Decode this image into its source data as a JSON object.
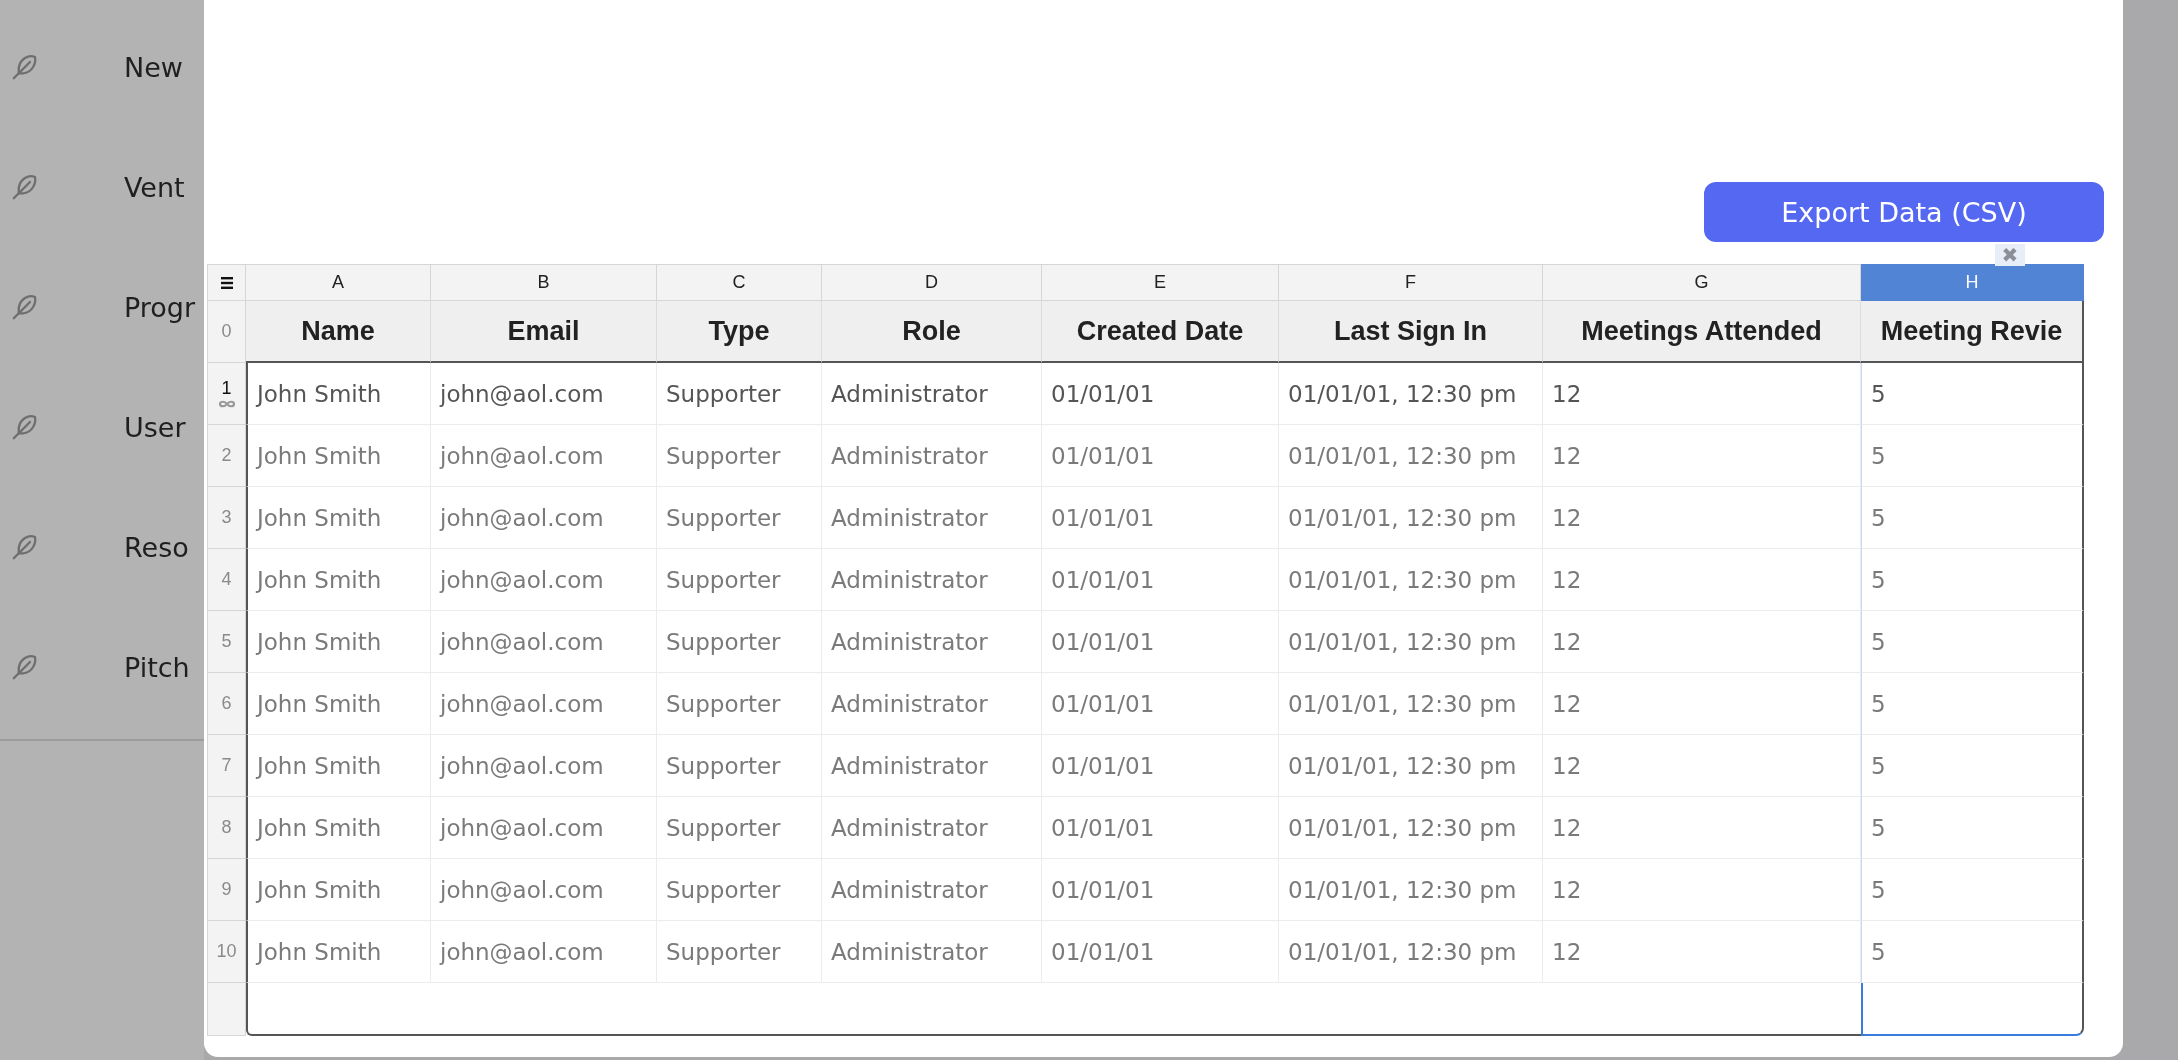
{
  "sidebar": {
    "items": [
      {
        "label": "New"
      },
      {
        "label": "Vent"
      },
      {
        "label": "Progr"
      },
      {
        "label": "User"
      },
      {
        "label": "Reso"
      },
      {
        "label": "Pitch"
      }
    ]
  },
  "export_button": {
    "label": "Export Data (CSV)"
  },
  "close_icon": "✖",
  "sheet": {
    "header_row_number": "0",
    "columns": [
      {
        "letter": "A",
        "header": "Name",
        "selected": false
      },
      {
        "letter": "B",
        "header": "Email",
        "selected": false
      },
      {
        "letter": "C",
        "header": "Type",
        "selected": false
      },
      {
        "letter": "D",
        "header": "Role",
        "selected": false
      },
      {
        "letter": "E",
        "header": "Created Date",
        "selected": false
      },
      {
        "letter": "F",
        "header": "Last Sign In",
        "selected": false
      },
      {
        "letter": "G",
        "header": "Meetings Attended",
        "selected": false
      },
      {
        "letter": "H",
        "header": "Meeting Revie",
        "selected": true
      }
    ],
    "rows": [
      {
        "number": "1",
        "highlighted": true,
        "cells": [
          "John Smith",
          "john@aol.com",
          "Supporter",
          "Administrator",
          "01/01/01",
          "01/01/01, 12:30 pm",
          "12",
          "5"
        ]
      },
      {
        "number": "2",
        "highlighted": false,
        "cells": [
          "John Smith",
          "john@aol.com",
          "Supporter",
          "Administrator",
          "01/01/01",
          "01/01/01, 12:30 pm",
          "12",
          "5"
        ]
      },
      {
        "number": "3",
        "highlighted": false,
        "cells": [
          "John Smith",
          "john@aol.com",
          "Supporter",
          "Administrator",
          "01/01/01",
          "01/01/01, 12:30 pm",
          "12",
          "5"
        ]
      },
      {
        "number": "4",
        "highlighted": false,
        "cells": [
          "John Smith",
          "john@aol.com",
          "Supporter",
          "Administrator",
          "01/01/01",
          "01/01/01, 12:30 pm",
          "12",
          "5"
        ]
      },
      {
        "number": "5",
        "highlighted": false,
        "cells": [
          "John Smith",
          "john@aol.com",
          "Supporter",
          "Administrator",
          "01/01/01",
          "01/01/01, 12:30 pm",
          "12",
          "5"
        ]
      },
      {
        "number": "6",
        "highlighted": false,
        "cells": [
          "John Smith",
          "john@aol.com",
          "Supporter",
          "Administrator",
          "01/01/01",
          "01/01/01, 12:30 pm",
          "12",
          "5"
        ]
      },
      {
        "number": "7",
        "highlighted": false,
        "cells": [
          "John Smith",
          "john@aol.com",
          "Supporter",
          "Administrator",
          "01/01/01",
          "01/01/01, 12:30 pm",
          "12",
          "5"
        ]
      },
      {
        "number": "8",
        "highlighted": false,
        "cells": [
          "John Smith",
          "john@aol.com",
          "Supporter",
          "Administrator",
          "01/01/01",
          "01/01/01, 12:30 pm",
          "12",
          "5"
        ]
      },
      {
        "number": "9",
        "highlighted": false,
        "cells": [
          "John Smith",
          "john@aol.com",
          "Supporter",
          "Administrator",
          "01/01/01",
          "01/01/01, 12:30 pm",
          "12",
          "5"
        ]
      },
      {
        "number": "10",
        "highlighted": false,
        "cells": [
          "John Smith",
          "john@aol.com",
          "Supporter",
          "Administrator",
          "01/01/01",
          "01/01/01, 12:30 pm",
          "12",
          "5"
        ]
      }
    ]
  }
}
